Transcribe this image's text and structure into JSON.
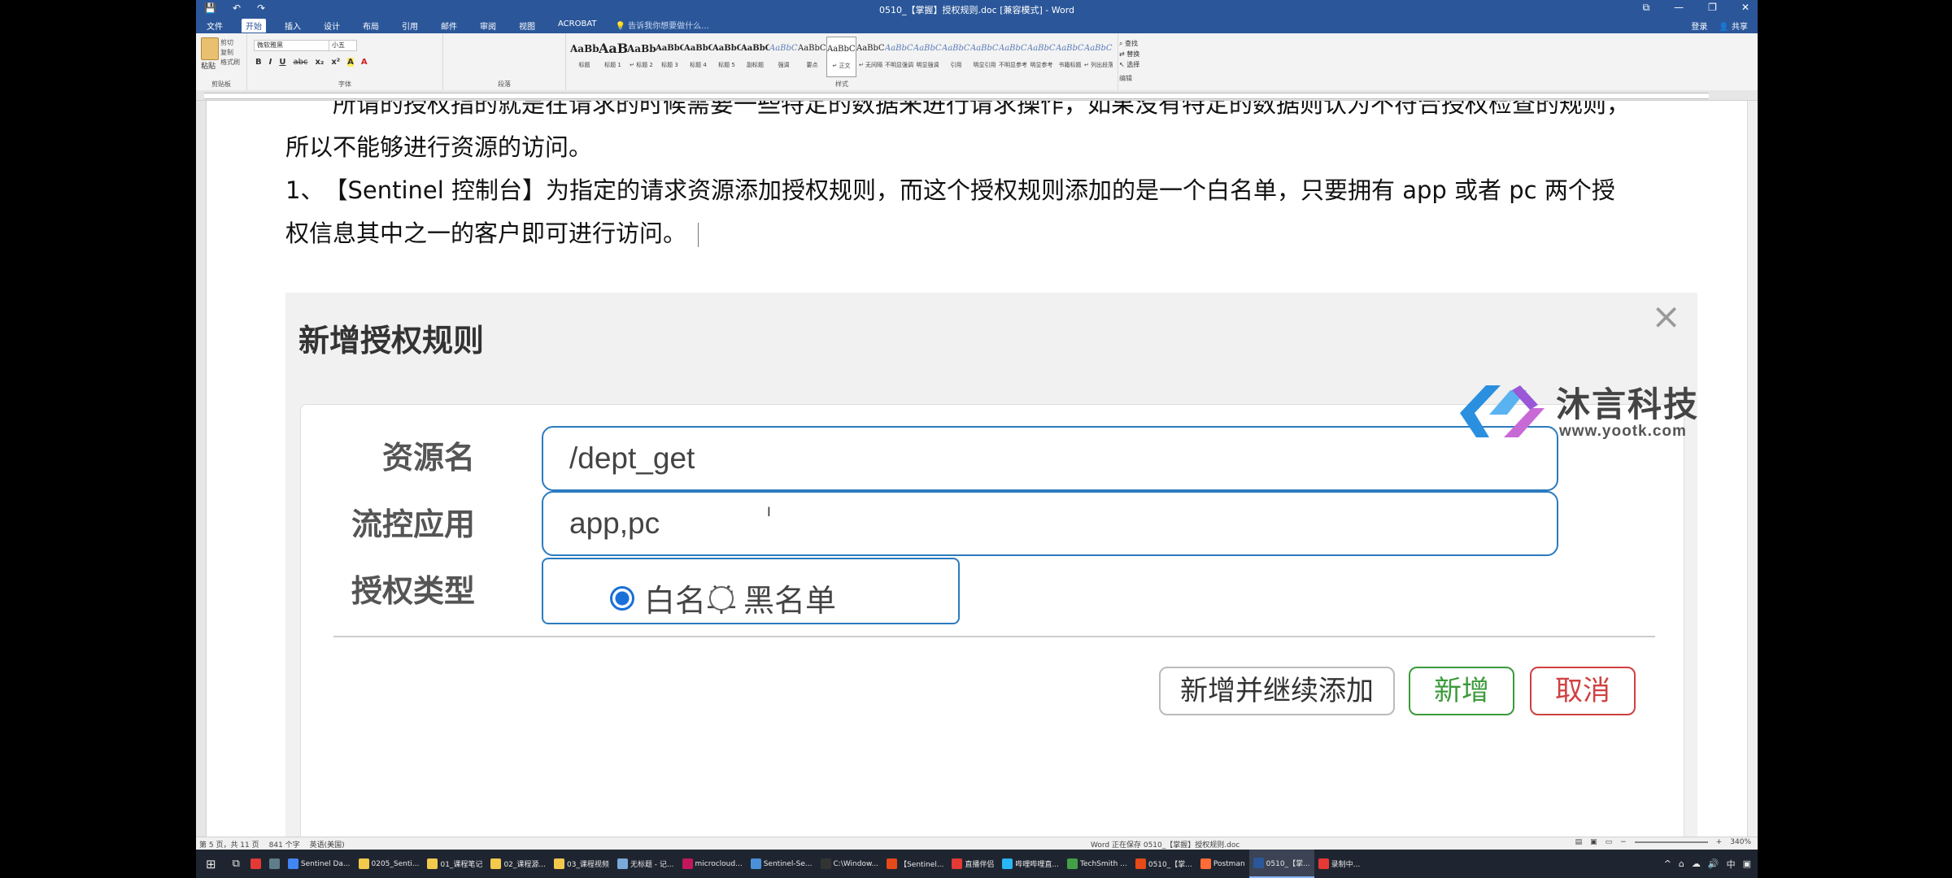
{
  "window": {
    "title": "0510_【掌握】授权规则.doc [兼容模式] - Word",
    "controls": [
      "⧉",
      "—",
      "❐",
      "✕"
    ]
  },
  "qat": {
    "save_icon": "save-icon",
    "undo_icon": "undo-icon",
    "redo_icon": "redo-icon"
  },
  "ribbon": {
    "tabs": [
      "文件",
      "开始",
      "插入",
      "设计",
      "布局",
      "引用",
      "邮件",
      "审阅",
      "视图",
      "ACROBAT"
    ],
    "tell_me": "告诉我你想要做什么...",
    "login": "登录",
    "share": "共享",
    "clipboard": {
      "paste": "粘贴",
      "items": [
        "剪切",
        "复制",
        "格式刷"
      ],
      "label": "剪贴板"
    },
    "font": {
      "name": "微软雅黑",
      "size": "小五",
      "format_buttons": [
        "B",
        "I",
        "U",
        "abc",
        "x₂",
        "x²",
        "A",
        "A"
      ],
      "label": "字体"
    },
    "paragraph_label": "段落",
    "styles": [
      {
        "sample": "AaBbC",
        "name": "标题"
      },
      {
        "sample": "AaBl",
        "name": "标题 1"
      },
      {
        "sample": "AaBb(",
        "name": "↵ 标题 2"
      },
      {
        "sample": "AaBbC",
        "name": "标题 3"
      },
      {
        "sample": "AaBbCc",
        "name": "标题 4"
      },
      {
        "sample": "AaBbC",
        "name": "标题 5"
      },
      {
        "sample": "AaBbC",
        "name": "副标题"
      },
      {
        "sample": "AaBbCcDı",
        "name": "强调"
      },
      {
        "sample": "AaBbCcD",
        "name": "要点"
      },
      {
        "sample": "AaBbCcDı",
        "name": "↵ 正文"
      },
      {
        "sample": "AaBbCcDı",
        "name": "↵ 无间隔"
      },
      {
        "sample": "AaBbCcDı",
        "name": "不明显强调"
      },
      {
        "sample": "AaBbCcDı",
        "name": "明显强调"
      },
      {
        "sample": "AaBbCcDı",
        "name": "引用"
      },
      {
        "sample": "AaBbCcDı",
        "name": "明显引用"
      },
      {
        "sample": "AaBbCcD",
        "name": "不明显参考"
      },
      {
        "sample": "AaBbCcI",
        "name": "明显参考"
      },
      {
        "sample": "AaBbCcD",
        "name": "书籍标题"
      },
      {
        "sample": "AaBbCcDı",
        "name": "↵ 列出段落"
      }
    ],
    "styles_label": "样式",
    "editing": {
      "find": "查找",
      "replace": "替换",
      "select": "选择",
      "label": "编辑"
    }
  },
  "document": {
    "para1": "所谓的授权指的就是在请求的时候需要一些特定的数据来进行请求操作，如果没有特定的数据则认为不符合授权检查的规则，",
    "para1_cont": "所以不能够进行资源的访问。",
    "para2": "1、　【Sentinel 控制台】为指定的请求资源添加授权规则，而这个授权规则添加的是一个白名单，只要拥有 app 或者 pc 两个授",
    "para2_cont": "权信息其中之一的客户即可进行访问。"
  },
  "dialog": {
    "title": "新增授权规则",
    "close": "×",
    "resource_label": "资源名",
    "resource_value": "/dept_get",
    "app_label": "流控应用",
    "app_value": "app,pc",
    "type_label": "授权类型",
    "type_options": [
      {
        "label": "白名单",
        "checked": true
      },
      {
        "label": "黑名单",
        "checked": false
      }
    ],
    "buttons": {
      "add_continue": "新增并继续添加",
      "add": "新增",
      "cancel": "取消"
    }
  },
  "watermark": {
    "name": "沐言科技",
    "url": "www.yootk.com"
  },
  "statusbar": {
    "page": "第 5 页，共 11 页",
    "words": "841 个字",
    "language": "英语(美国)",
    "recovered": "Word 正在保存 0510_【掌握】授权规则.doc",
    "zoom": "340%"
  },
  "taskbar": {
    "items": [
      {
        "label": "Sentinel Da...",
        "color": "#4285f4"
      },
      {
        "label": "0205_Senti...",
        "color": "#f2c94c"
      },
      {
        "label": "01_课程笔记",
        "color": "#f2c94c"
      },
      {
        "label": "02_课程源...",
        "color": "#f2c94c"
      },
      {
        "label": "03_课程视频",
        "color": "#f2c94c"
      },
      {
        "label": "无标题 - 记...",
        "color": "#7aa9d9"
      },
      {
        "label": "microcloud...",
        "color": "#c2185b"
      },
      {
        "label": "Sentinel-Se...",
        "color": "#4a90d9"
      },
      {
        "label": "C:\\Window...",
        "color": "#333333"
      },
      {
        "label": "【Sentinel...",
        "color": "#e64a19"
      },
      {
        "label": "直播伴侣",
        "color": "#e53935"
      },
      {
        "label": "哔哩哔哩直...",
        "color": "#29b6f6"
      },
      {
        "label": "TechSmith ...",
        "color": "#43a047"
      },
      {
        "label": "0510_【掌...",
        "color": "#e64a19"
      },
      {
        "label": "Postman",
        "color": "#ff6c37"
      },
      {
        "label": "0510_【掌...",
        "color": "#2b579a"
      },
      {
        "label": "录制中...",
        "color": "#e53935"
      }
    ],
    "tray": [
      "^",
      "⌂",
      "☁",
      "🔊",
      "中",
      "▣"
    ]
  },
  "colors": {
    "word_blue": "#2b579a",
    "input_border": "#2b7bbf",
    "radio_checked": "#1a6fd8",
    "btn_green": "#3b9a3b",
    "btn_red": "#d04040"
  }
}
